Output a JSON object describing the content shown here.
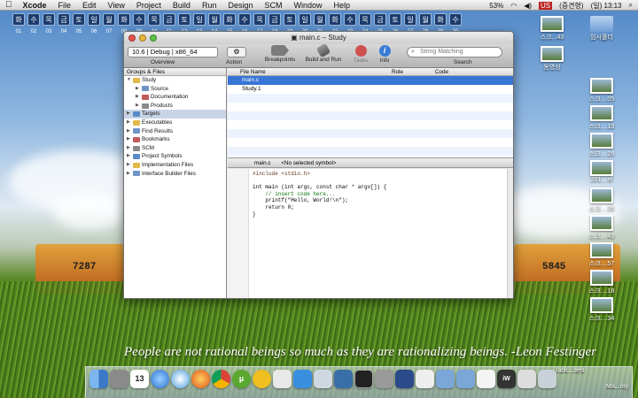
{
  "menubar": {
    "app": "Xcode",
    "items": [
      "File",
      "Edit",
      "View",
      "Project",
      "Build",
      "Run",
      "Design",
      "SCM",
      "Window",
      "Help"
    ],
    "right": {
      "clock": "(일) 13:13",
      "input_method": "(증견형)",
      "flag": "US",
      "cpu": "53%"
    }
  },
  "hangul_strip": {
    "keys": [
      "화",
      "수",
      "목",
      "금",
      "토",
      "일",
      "월",
      "화",
      "수",
      "목",
      "금",
      "토",
      "일",
      "월",
      "화",
      "수",
      "목",
      "금",
      "토",
      "일",
      "월",
      "화",
      "수",
      "목",
      "금",
      "토",
      "일",
      "월",
      "화",
      "수"
    ],
    "nums": [
      "01",
      "02",
      "03",
      "04",
      "05",
      "06",
      "07",
      "08",
      "09",
      "10",
      "11",
      "12",
      "13",
      "14",
      "15",
      "16",
      "17",
      "18",
      "19",
      "20",
      "21",
      "22",
      "23",
      "24",
      "25",
      "26",
      "27",
      "28",
      "29",
      "30"
    ]
  },
  "window": {
    "title": "main.c – Study",
    "toolbar": {
      "scheme": "10.6 | Debug | x86_64",
      "gear": "⚙",
      "buttons": [
        {
          "label": "Overview"
        },
        {
          "label": "Action"
        },
        {
          "label": "Breakpoints"
        },
        {
          "label": "Build and Run"
        },
        {
          "label": "Tasks"
        },
        {
          "label": "Info"
        },
        {
          "label": "Search"
        }
      ],
      "search_placeholder": "String Matching"
    },
    "sidebar": {
      "header": "Groups & Files",
      "tree": [
        {
          "label": "Study",
          "depth": 0,
          "open": true
        },
        {
          "label": "Source",
          "depth": 1
        },
        {
          "label": "Documentation",
          "depth": 1
        },
        {
          "label": "Products",
          "depth": 1
        },
        {
          "label": "Targets",
          "depth": 0,
          "selected": true
        },
        {
          "label": "Executables",
          "depth": 0
        },
        {
          "label": "Find Results",
          "depth": 0
        },
        {
          "label": "Bookmarks",
          "depth": 0
        },
        {
          "label": "SCM",
          "depth": 0
        },
        {
          "label": "Project Symbols",
          "depth": 0
        },
        {
          "label": "Implementation Files",
          "depth": 0
        },
        {
          "label": "Interface Builder Files",
          "depth": 0
        }
      ]
    },
    "filelist": {
      "columns": [
        "File Name",
        "Role",
        "Code"
      ],
      "rows": [
        "main.c",
        "Study.1"
      ]
    },
    "editor": {
      "file": "main.c",
      "symbol": "<No selected symbol>",
      "code": [
        {
          "t": "#include <stdio.h>",
          "c": "c-pp"
        },
        {
          "t": "",
          "c": "c-tx"
        },
        {
          "t": "int main (int argc, const char * argv[]) {",
          "c": "c-tx"
        },
        {
          "t": "    // insert code here...",
          "c": "c-cm"
        },
        {
          "t": "    printf(\"Hello, World!\\n\");",
          "c": "c-tx"
        },
        {
          "t": "    return 0;",
          "c": "c-tx"
        },
        {
          "t": "}",
          "c": "c-tx"
        }
      ]
    }
  },
  "desktop_icons": [
    {
      "label": "스크...43",
      "kind": "thumb"
    },
    {
      "label": "임시폴더",
      "kind": "folder"
    },
    {
      "label": "동영상",
      "kind": "thumb"
    },
    {
      "label": "스크....05",
      "kind": "thumb"
    },
    {
      "label": "스크....13",
      "kind": "thumb"
    },
    {
      "label": "스크....28",
      "kind": "thumb"
    },
    {
      "label": "201....el",
      "kind": "thumb"
    },
    {
      "label": "스크....35",
      "kind": "thumb"
    },
    {
      "label": "스크....43",
      "kind": "thumb"
    },
    {
      "label": "스크....57",
      "kind": "thumb"
    },
    {
      "label": "스크....18",
      "kind": "thumb"
    },
    {
      "label": "스크....34",
      "kind": "thumb"
    }
  ],
  "quote": "People are not rational beings so much as they are rationalizing beings. -Leon Festinger",
  "dock": {
    "labels": [
      "luck....test",
      "Ma...ray"
    ],
    "calendar_day": "13"
  }
}
